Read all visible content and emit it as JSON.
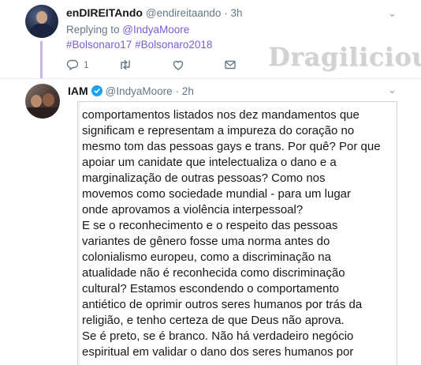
{
  "tweet1": {
    "display_name": "enDIREITAndo",
    "handle": "@endireitaando",
    "time": "· 3h",
    "replying_prefix": "Replying to ",
    "replying_to": "@IndyaMoore",
    "hashtags": "#Bolsonaro17 #Bolsonaro2018",
    "actions": {
      "reply_count": "1",
      "retweet_count": "",
      "like_count": ""
    }
  },
  "watermark": "Dragilicious",
  "tweet2": {
    "display_name": "IAM",
    "handle": "@IndyaMoore",
    "time": "· 2h",
    "lines": [
      "comportamentos listados nos dez mandamentos que",
      "significam e representam a impureza do coração no",
      "mesmo tom das pessoas gays e trans. Por quê? Por que",
      "apoiar um canidate que intelectualiza o dano e a",
      "marginalização de outras pessoas? Como nos",
      "movemos como sociedade mundial - para um lugar",
      "onde aprovamos a violência interpessoal?",
      "E se o reconhecimento e o respeito das pessoas",
      "variantes de gênero fosse uma norma antes do",
      "colonialismo europeu, como a discriminação na",
      "atualidade não é reconhecida como discriminação",
      "cultural? Estamos escondendo o comportamento",
      "antiético de oprimir outros seres humanos por trás da",
      "religião, e tenho certeza de que Deus não aprova.",
      "Se é preto, se é branco. Não há verdadeiro negócio",
      "espiritual em validar o dano dos seres humanos por"
    ]
  },
  "colors": {
    "link_purple": "#7a5bd6",
    "thread_line": "#c9b3e8",
    "verified_blue": "#1da1f2",
    "muted_gray": "#657786"
  }
}
